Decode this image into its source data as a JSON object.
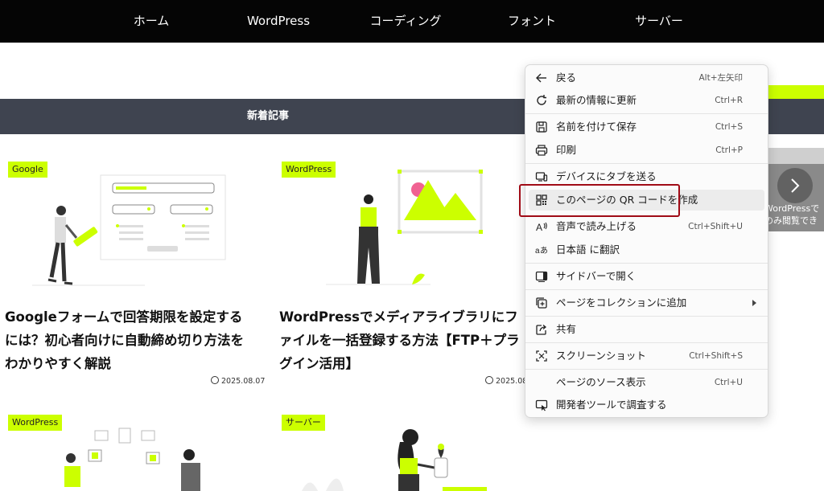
{
  "nav": [
    "ホーム",
    "WordPress",
    "コーディング",
    "フォント",
    "サーバー"
  ],
  "section_title": "新着記事",
  "cards": [
    {
      "tag": "Google",
      "title": "Googleフォームで回答期限を設定するには？初心者向けに自動締め切り方法をわかりやすく解説",
      "date": "2025.08.07"
    },
    {
      "tag": "WordPress",
      "title": "WordPressでメディアライブラリにファイルを一括登録する方法【FTP＋プラグイン活用】",
      "date": "2025.08.0"
    },
    {
      "tag": "WordPress"
    },
    {
      "tag": "サーバー"
    }
  ],
  "partial_card_text": "WordPressで\nのみ閲覧でき",
  "context_menu": {
    "items": [
      {
        "icon": "back-arrow-icon",
        "label": "戻る",
        "shortcut": "Alt+左矢印"
      },
      {
        "icon": "refresh-icon",
        "label": "最新の情報に更新",
        "shortcut": "Ctrl+R"
      },
      {
        "icon": "save-icon",
        "label": "名前を付けて保存",
        "shortcut": "Ctrl+S"
      },
      {
        "icon": "print-icon",
        "label": "印刷",
        "shortcut": "Ctrl+P"
      },
      {
        "icon": "send-to-device-icon",
        "label": "デバイスにタブを送る",
        "shortcut": ""
      },
      {
        "icon": "qr-code-icon",
        "label": "このページの QR コードを作成",
        "shortcut": ""
      },
      {
        "icon": "read-aloud-icon",
        "label": "音声で読み上げる",
        "shortcut": "Ctrl+Shift+U"
      },
      {
        "icon": "translate-icon",
        "label": "日本語 に翻訳",
        "shortcut": ""
      },
      {
        "icon": "sidebar-icon",
        "label": "サイドバーで開く",
        "shortcut": ""
      },
      {
        "icon": "collections-icon",
        "label": "ページをコレクションに追加",
        "shortcut": ""
      },
      {
        "icon": "share-icon",
        "label": "共有",
        "shortcut": ""
      },
      {
        "icon": "screenshot-icon",
        "label": "スクリーンショット",
        "shortcut": "Ctrl+Shift+S"
      },
      {
        "icon": "",
        "label": "ページのソース表示",
        "shortcut": "Ctrl+U"
      },
      {
        "icon": "devtools-icon",
        "label": "開発者ツールで調査する",
        "shortcut": ""
      }
    ]
  },
  "colors": {
    "accent": "#ccff00",
    "nav_bg": "#050505",
    "section_bg": "#3f4450",
    "highlight_border": "#a00b16"
  }
}
